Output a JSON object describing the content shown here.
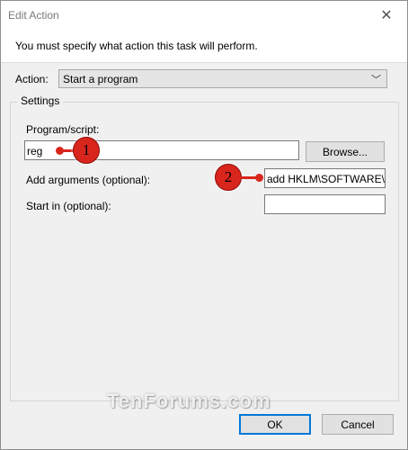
{
  "window": {
    "title": "Edit Action",
    "close_glyph": "✕"
  },
  "instruction": "You must specify what action this task will perform.",
  "action": {
    "label": "Action:",
    "value": "Start a program",
    "arrow": "﹀"
  },
  "settings": {
    "title": "Settings",
    "program": {
      "label": "Program/script:",
      "value": "reg",
      "browse_label": "Browse..."
    },
    "arguments": {
      "label": "Add arguments (optional):",
      "value": "add HKLM\\SOFTWARE\\M"
    },
    "start_in": {
      "label": "Start in (optional):",
      "value": ""
    }
  },
  "annotations": {
    "marker1": "1",
    "marker2": "2",
    "accent_color": "#d9261c"
  },
  "watermark": "TenForums.com",
  "buttons": {
    "ok": "OK",
    "cancel": "Cancel"
  }
}
